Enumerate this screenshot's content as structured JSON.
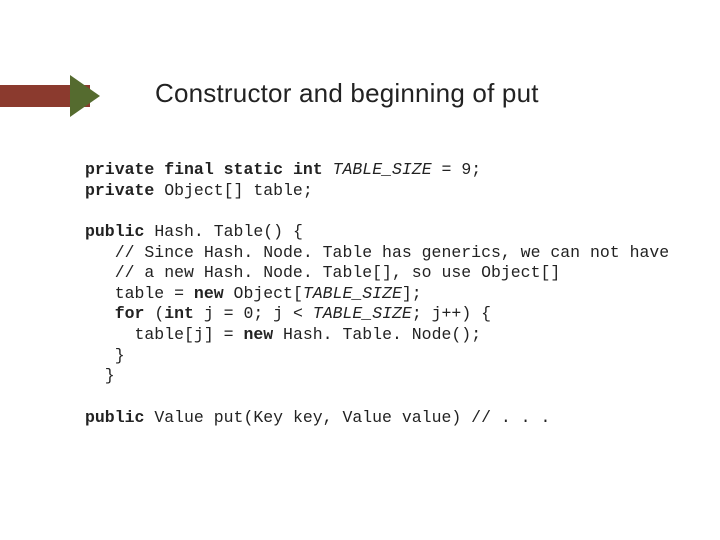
{
  "title": "Constructor and beginning of put",
  "kw": {
    "private": "private",
    "final": "final",
    "static": "static",
    "int": "int",
    "public": "public",
    "new": "new",
    "for": "for"
  },
  "c": {
    "tableSize": "TABLE_SIZE",
    "eq9": " = 9;",
    "objArrDecl": " Object[] table;",
    "hashTableCtor": " Hash. Table() {",
    "comment1": "   // Since Hash. Node. Table has generics, we can not have",
    "comment2": "   // a new Hash. Node. Table[], so use Object[]",
    "tableAssign1": "   table = ",
    "tableAssign2": " Object[",
    "tableAssign3": "];",
    "for1": " (",
    "for2": " j = 0; j < ",
    "for3": "; j++) {",
    "inner1": "     table[j] = ",
    "inner2": " Hash. Table. Node();",
    "closeInner": "   }",
    "closeCtor": "  }",
    "putSig": " Value put(Key key, Value value) // . . ."
  }
}
